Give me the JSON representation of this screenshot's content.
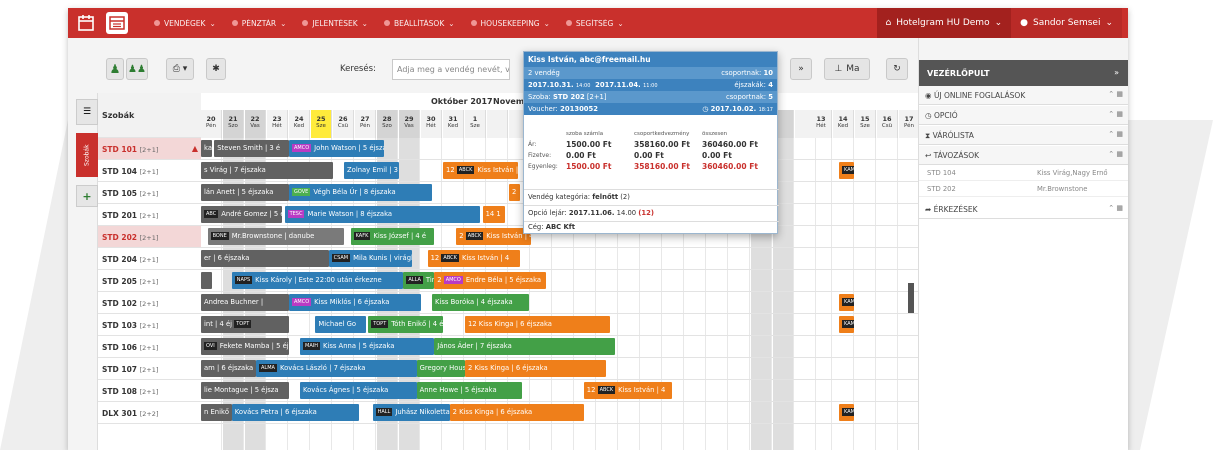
{
  "nav": {
    "items": [
      "VENDÉGEK",
      "PÉNZTÁR",
      "JELENTÉSEK",
      "BEÁLLÍTÁSOK",
      "HOUSEKEEPING",
      "SEGÍTSÉG"
    ],
    "hotel": "Hotelgram HU Demo",
    "user": "Sandor Semsei"
  },
  "toolbar": {
    "search_label": "Keresés:",
    "search_placeholder": "Adja meg a vendég nevét, vi",
    "nav_next": "»",
    "today": "Ma"
  },
  "left_rail": {
    "tab_label": "Szobák"
  },
  "calendar": {
    "rooms_header": "Szobák",
    "month_label": "Október 2017",
    "month_label_2": "Novem",
    "days": [
      {
        "num": "20",
        "dow": "Pén",
        "shade": "none"
      },
      {
        "num": "21",
        "dow": "Szo",
        "shade": "gray"
      },
      {
        "num": "22",
        "dow": "Vas",
        "shade": "gray"
      },
      {
        "num": "23",
        "dow": "Hét",
        "shade": "none"
      },
      {
        "num": "24",
        "dow": "Ked",
        "shade": "none"
      },
      {
        "num": "25",
        "dow": "Sze",
        "shade": "today"
      },
      {
        "num": "26",
        "dow": "Csü",
        "shade": "none"
      },
      {
        "num": "27",
        "dow": "Pén",
        "shade": "none"
      },
      {
        "num": "28",
        "dow": "Szo",
        "shade": "gray"
      },
      {
        "num": "29",
        "dow": "Vas",
        "shade": "gray"
      },
      {
        "num": "30",
        "dow": "Hét",
        "shade": "none"
      },
      {
        "num": "31",
        "dow": "Ked",
        "shade": "none"
      },
      {
        "num": "1",
        "dow": "Sze",
        "shade": "none"
      }
    ],
    "days_right": [
      {
        "num": "13",
        "dow": "Hét"
      },
      {
        "num": "14",
        "dow": "Ked"
      },
      {
        "num": "15",
        "dow": "Sze"
      },
      {
        "num": "16",
        "dow": "Csü"
      },
      {
        "num": "17",
        "dow": "Pén"
      }
    ],
    "rooms": [
      {
        "name": "STD 101",
        "cap": "[2+1]",
        "style": "red",
        "alert": true
      },
      {
        "name": "STD 104",
        "cap": "[2+1]",
        "style": ""
      },
      {
        "name": "STD 105",
        "cap": "[2+1]",
        "style": ""
      },
      {
        "name": "STD 201",
        "cap": "[2+1]",
        "style": ""
      },
      {
        "name": "STD 202",
        "cap": "[2+1]",
        "style": "red"
      },
      {
        "name": "STD 204",
        "cap": "[2+1]",
        "style": ""
      },
      {
        "name": "STD 205",
        "cap": "[2+1]",
        "style": ""
      },
      {
        "name": "STD 102",
        "cap": "[2+1]",
        "style": ""
      },
      {
        "name": "STD 103",
        "cap": "[2+1]",
        "style": ""
      },
      {
        "name": "STD 106",
        "cap": "[2+1]",
        "style": ""
      },
      {
        "name": "STD 107",
        "cap": "[2+1]",
        "style": ""
      },
      {
        "name": "STD 108",
        "cap": "[2+1]",
        "style": ""
      },
      {
        "name": "DLX 301",
        "cap": "[2+2]",
        "style": ""
      }
    ],
    "bookings": [
      {
        "row": 0,
        "c0": 0,
        "c1": 0.5,
        "color": "dg",
        "tag": "",
        "text": "ka"
      },
      {
        "row": 0,
        "c0": 0.6,
        "c1": 4,
        "color": "dg",
        "tag": "",
        "text": "Steven Smith | 3 é"
      },
      {
        "row": 0,
        "c0": 4,
        "c1": 8.3,
        "color": "b",
        "tag": "AMCO",
        "tagc": "p",
        "text": "John Watson | 5 éjszaka"
      },
      {
        "row": 1,
        "c0": 0,
        "c1": 6,
        "color": "dg",
        "tag": "",
        "text": "s Virág | 7 éjszaka"
      },
      {
        "row": 1,
        "c0": 6.5,
        "c1": 9,
        "color": "b",
        "tag": "",
        "text": "Zolnay Emil | 3 éj"
      },
      {
        "row": 1,
        "c0": 11,
        "c1": 14.4,
        "color": "o",
        "tag": "ABCK",
        "tagc": "",
        "text": "12  Kiss István | 4"
      },
      {
        "row": 1,
        "c0": 29,
        "c1": 29.7,
        "color": "o",
        "tag": "KAM",
        "tagc": "",
        "text": "2"
      },
      {
        "row": 2,
        "c0": 0,
        "c1": 4,
        "color": "dg",
        "tag": "",
        "text": "lán Anett | 5 éjszaka"
      },
      {
        "row": 2,
        "c0": 4,
        "c1": 10.5,
        "color": "b",
        "tag": "GOVE",
        "tagc": "g",
        "text": "Végh Béla Úr | 8 éjszaka"
      },
      {
        "row": 2,
        "c0": 14,
        "c1": 14.5,
        "color": "o",
        "tag": "",
        "text": "2"
      },
      {
        "row": 3,
        "c0": 0,
        "c1": 3.7,
        "color": "dg",
        "tag": "ABC",
        "tagc": "",
        "text": "André Gomez | 5 éjszak"
      },
      {
        "row": 3,
        "c0": 3.8,
        "c1": 12.7,
        "color": "b",
        "tag": "TESC",
        "tagc": "p",
        "text": "Marie Watson | 8 éjszaka"
      },
      {
        "row": 3,
        "c0": 12.8,
        "c1": 13.8,
        "color": "o",
        "tag": "",
        "text": "14 1"
      },
      {
        "row": 4,
        "c0": 0.3,
        "c1": 6.5,
        "color": "dgl",
        "tag": "BONE",
        "tagc": "",
        "text": "Mr.Brownstone | danube"
      },
      {
        "row": 4,
        "c0": 6.8,
        "c1": 10.6,
        "color": "gr",
        "tag": "KAFK",
        "tagc": "",
        "text": "Kiss József | 4 é"
      },
      {
        "row": 4,
        "c0": 11.6,
        "c1": 15,
        "color": "o",
        "tag": "ABCK",
        "tagc": "",
        "text": "2  Kiss István | 4"
      },
      {
        "row": 5,
        "c0": 0,
        "c1": 5.8,
        "color": "dg",
        "tag": "",
        "text": "er | 6 éjszaka"
      },
      {
        "row": 5,
        "c0": 5.8,
        "c1": 9.6,
        "color": "b",
        "tag": "CSAM",
        "tagc": "",
        "text": "Mila Kunis | virágl"
      },
      {
        "row": 5,
        "c0": 10.3,
        "c1": 14.5,
        "color": "o",
        "tag": "ABCK",
        "tagc": "",
        "text": "12  Kiss István | 4"
      },
      {
        "row": 6,
        "c0": 0,
        "c1": 0.5,
        "color": "dg",
        "tag": "",
        "text": ""
      },
      {
        "row": 6,
        "c0": 1.4,
        "c1": 9.2,
        "color": "b",
        "tag": "NAPS",
        "tagc": "",
        "text": "Kiss Károly | Este 22:00 után érkezne"
      },
      {
        "row": 6,
        "c0": 9.2,
        "c1": 10.6,
        "color": "gr",
        "tag": "ALLA",
        "tagc": "",
        "text": "Timo"
      },
      {
        "row": 6,
        "c0": 10.6,
        "c1": 15.7,
        "color": "o",
        "tag": "AMCO",
        "tagc": "p",
        "text": "2  Endre Béla | 5 éjszaka"
      },
      {
        "row": 7,
        "c0": 0,
        "c1": 4,
        "color": "dg",
        "tag": "",
        "text": "Andrea Buchner |"
      },
      {
        "row": 7,
        "c0": 4,
        "c1": 10,
        "color": "b",
        "tag": "AMCO",
        "tagc": "p",
        "text": "Kiss Miklós | 6 éjszaka"
      },
      {
        "row": 7,
        "c0": 10.5,
        "c1": 14.9,
        "color": "gr",
        "tag": "",
        "text": "Kiss Boróka | 4 éjszaka"
      },
      {
        "row": 7,
        "c0": 29,
        "c1": 29.7,
        "color": "o",
        "tag": "KAM",
        "tagc": "",
        "text": "2"
      },
      {
        "row": 8,
        "c0": 0,
        "c1": 4,
        "color": "dg",
        "tag": "TOPT",
        "tagc": "",
        "text": "int | 4 éj    Micheala H"
      },
      {
        "row": 8,
        "c0": 5.2,
        "c1": 7.5,
        "color": "b",
        "tag": "",
        "text": "Michael Go"
      },
      {
        "row": 8,
        "c0": 7.6,
        "c1": 11,
        "color": "gr",
        "tag": "TOPT",
        "tagc": "",
        "text": "Tóth Enikő | 4 éj"
      },
      {
        "row": 8,
        "c0": 12,
        "c1": 18.6,
        "color": "o",
        "tag": "",
        "text": "12  Kiss Kinga | 6 éjszaka"
      },
      {
        "row": 8,
        "c0": 29,
        "c1": 29.7,
        "color": "o",
        "tag": "KAM",
        "tagc": "",
        "text": "2"
      },
      {
        "row": 9,
        "c0": 0,
        "c1": 4,
        "color": "dg",
        "tag": "OVI",
        "tagc": "",
        "text": "Fekete Mamba | 5 éjszal"
      },
      {
        "row": 9,
        "c0": 4.5,
        "c1": 10.6,
        "color": "b",
        "tag": "MAIH",
        "tagc": "",
        "text": "Kiss Anna | 5 éjszaka"
      },
      {
        "row": 9,
        "c0": 10.6,
        "c1": 18.8,
        "color": "gr",
        "tag": "",
        "text": "János Áder | 7 éjszaka"
      },
      {
        "row": 10,
        "c0": 0,
        "c1": 2.5,
        "color": "dg",
        "tag": "",
        "text": "am | 6 éjszaka"
      },
      {
        "row": 10,
        "c0": 2.5,
        "c1": 9.8,
        "color": "b",
        "tag": "ALMA",
        "tagc": "",
        "text": "Kovács László | 7 éjszaka"
      },
      {
        "row": 10,
        "c0": 9.8,
        "c1": 12,
        "color": "gr",
        "tag": "",
        "text": "Gregory House |"
      },
      {
        "row": 10,
        "c0": 12,
        "c1": 18.4,
        "color": "o",
        "tag": "",
        "text": "2  Kiss Kinga | 6 éjszaka"
      },
      {
        "row": 11,
        "c0": 0,
        "c1": 4,
        "color": "dg",
        "tag": "",
        "text": "lie Montague | 5 éjsza"
      },
      {
        "row": 11,
        "c0": 4.5,
        "c1": 9.8,
        "color": "b",
        "tag": "",
        "text": "Kovács Ágnes | 5 éjszaka"
      },
      {
        "row": 11,
        "c0": 9.8,
        "c1": 14.6,
        "color": "gr",
        "tag": "",
        "text": "Anne Howe | 5 éjszaka"
      },
      {
        "row": 11,
        "c0": 17.4,
        "c1": 21.4,
        "color": "o",
        "tag": "ABCK",
        "tagc": "",
        "text": "12  Kiss István | 4"
      },
      {
        "row": 12,
        "c0": 0,
        "c1": 1.4,
        "color": "dg",
        "tag": "",
        "text": "n Enikő |"
      },
      {
        "row": 12,
        "c0": 1.4,
        "c1": 7.2,
        "color": "b",
        "tag": "",
        "text": "Kovács Petra | 6 éjszaka"
      },
      {
        "row": 12,
        "c0": 7.8,
        "c1": 11.3,
        "color": "b",
        "tag": "HALL",
        "tagc": "",
        "text": "Juhász Nikoletta |"
      },
      {
        "row": 12,
        "c0": 11.3,
        "c1": 17.4,
        "color": "o",
        "tag": "",
        "text": "2  Kiss Kinga | 6 éjszaka"
      },
      {
        "row": 12,
        "c0": 29,
        "c1": 29.7,
        "color": "o",
        "tag": "KAM",
        "tagc": "",
        "text": "2"
      }
    ]
  },
  "popup": {
    "title": "Kiss István, abc@freemail.hu",
    "guests": "2 vendég",
    "group_label": "csoportnak:",
    "group_value": "10",
    "dates_from": "2017.10.31.",
    "dates_from_time": "14:00",
    "dates_to": "2017.11.04.",
    "dates_to_time": "11:00",
    "nights_label": "éjszakák:",
    "nights_value": "4",
    "room_label": "Szoba:",
    "room_value": "STD 202",
    "room_cap": "[2+1]",
    "group_label_2": "csoportnak:",
    "group_value_2": "5",
    "voucher_label": "Voucher:",
    "voucher_value": "20130052",
    "voucher_date": "2017.10.02.",
    "voucher_time": "18:17",
    "col_headers": [
      "szoba számla",
      "csoportkedvezmény",
      "összesen"
    ],
    "rows": [
      {
        "label": "Ár:",
        "v": [
          "1500.00 Ft",
          "358160.00 Ft",
          "360460.00 Ft"
        ]
      },
      {
        "label": "Fizetve:",
        "v": [
          "0.00 Ft",
          "0.00 Ft",
          "0.00 Ft"
        ]
      },
      {
        "label": "Egyenleg:",
        "v": [
          "1500.00 Ft",
          "358160.00 Ft",
          "360460.00 Ft"
        ]
      }
    ],
    "category_label": "Vendég kategória:",
    "category_value": "felnőtt",
    "category_count": "(2)",
    "option_label": "Opció lejár:",
    "option_date": "2017.11.06.",
    "option_time": "14.00",
    "option_count": "(12)",
    "company_label": "Cég:",
    "company_value": "ABC Kft"
  },
  "right_panel": {
    "title": "VEZÉRLŐPULT",
    "sections": [
      {
        "label": "ÚJ ONLINE FOGLALÁSOK",
        "icon": "globe-icon"
      },
      {
        "label": "OPCIÓ",
        "icon": "clock-icon"
      },
      {
        "label": "VÁRÓLISTA",
        "icon": "hourglass-icon"
      },
      {
        "label": "TÁVOZÁSOK",
        "icon": "reply-icon"
      }
    ],
    "departures": [
      {
        "room": "STD 104",
        "guests": "Kiss Virág,Nagy Ernő"
      },
      {
        "room": "STD 202",
        "guests": "Mr.Brownstone"
      }
    ],
    "arrivals_label": "ÉRKEZÉSEK"
  },
  "colors": {
    "brand_red": "#c9302c",
    "blue": "#2e7db6",
    "green": "#43a047",
    "orange": "#ef7f1a",
    "gray": "#616161"
  }
}
